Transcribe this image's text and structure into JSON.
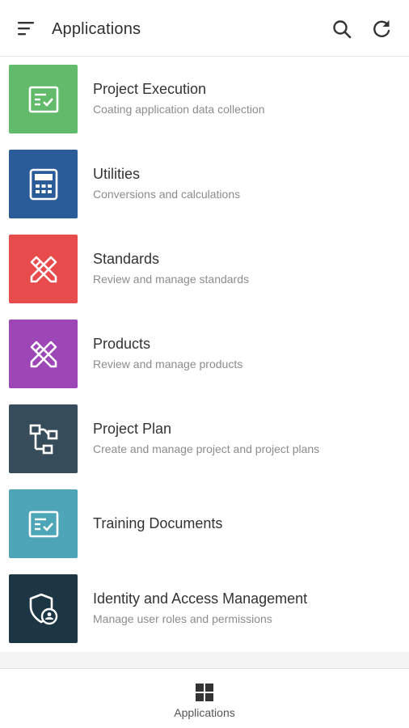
{
  "header": {
    "title": "Applications",
    "menu_icon": "menu-icon",
    "search_icon": "search-icon",
    "refresh_icon": "refresh-icon"
  },
  "apps": [
    {
      "title": "Project Execution",
      "subtitle": "Coating application data collection",
      "color": "#62bb6a",
      "icon": "checklist-icon"
    },
    {
      "title": "Utilities",
      "subtitle": "Conversions and calculations",
      "color": "#2b5c9a",
      "icon": "calculator-icon"
    },
    {
      "title": "Standards",
      "subtitle": "Review and manage standards",
      "color": "#e84b4b",
      "icon": "design-tools-icon"
    },
    {
      "title": "Products",
      "subtitle": "Review and manage products",
      "color": "#9d46b6",
      "icon": "design-tools-icon"
    },
    {
      "title": "Project Plan",
      "subtitle": "Create and manage project and project plans",
      "color": "#364c5a",
      "icon": "workflow-icon"
    },
    {
      "title": "Training Documents",
      "subtitle": "",
      "color": "#4ea5b7",
      "icon": "checklist-icon"
    },
    {
      "title": "Identity and Access Management",
      "subtitle": "Manage user roles and permissions",
      "color": "#1d3644",
      "icon": "shield-user-icon"
    }
  ],
  "bottom_nav": {
    "label": "Applications",
    "icon": "grid-icon"
  }
}
